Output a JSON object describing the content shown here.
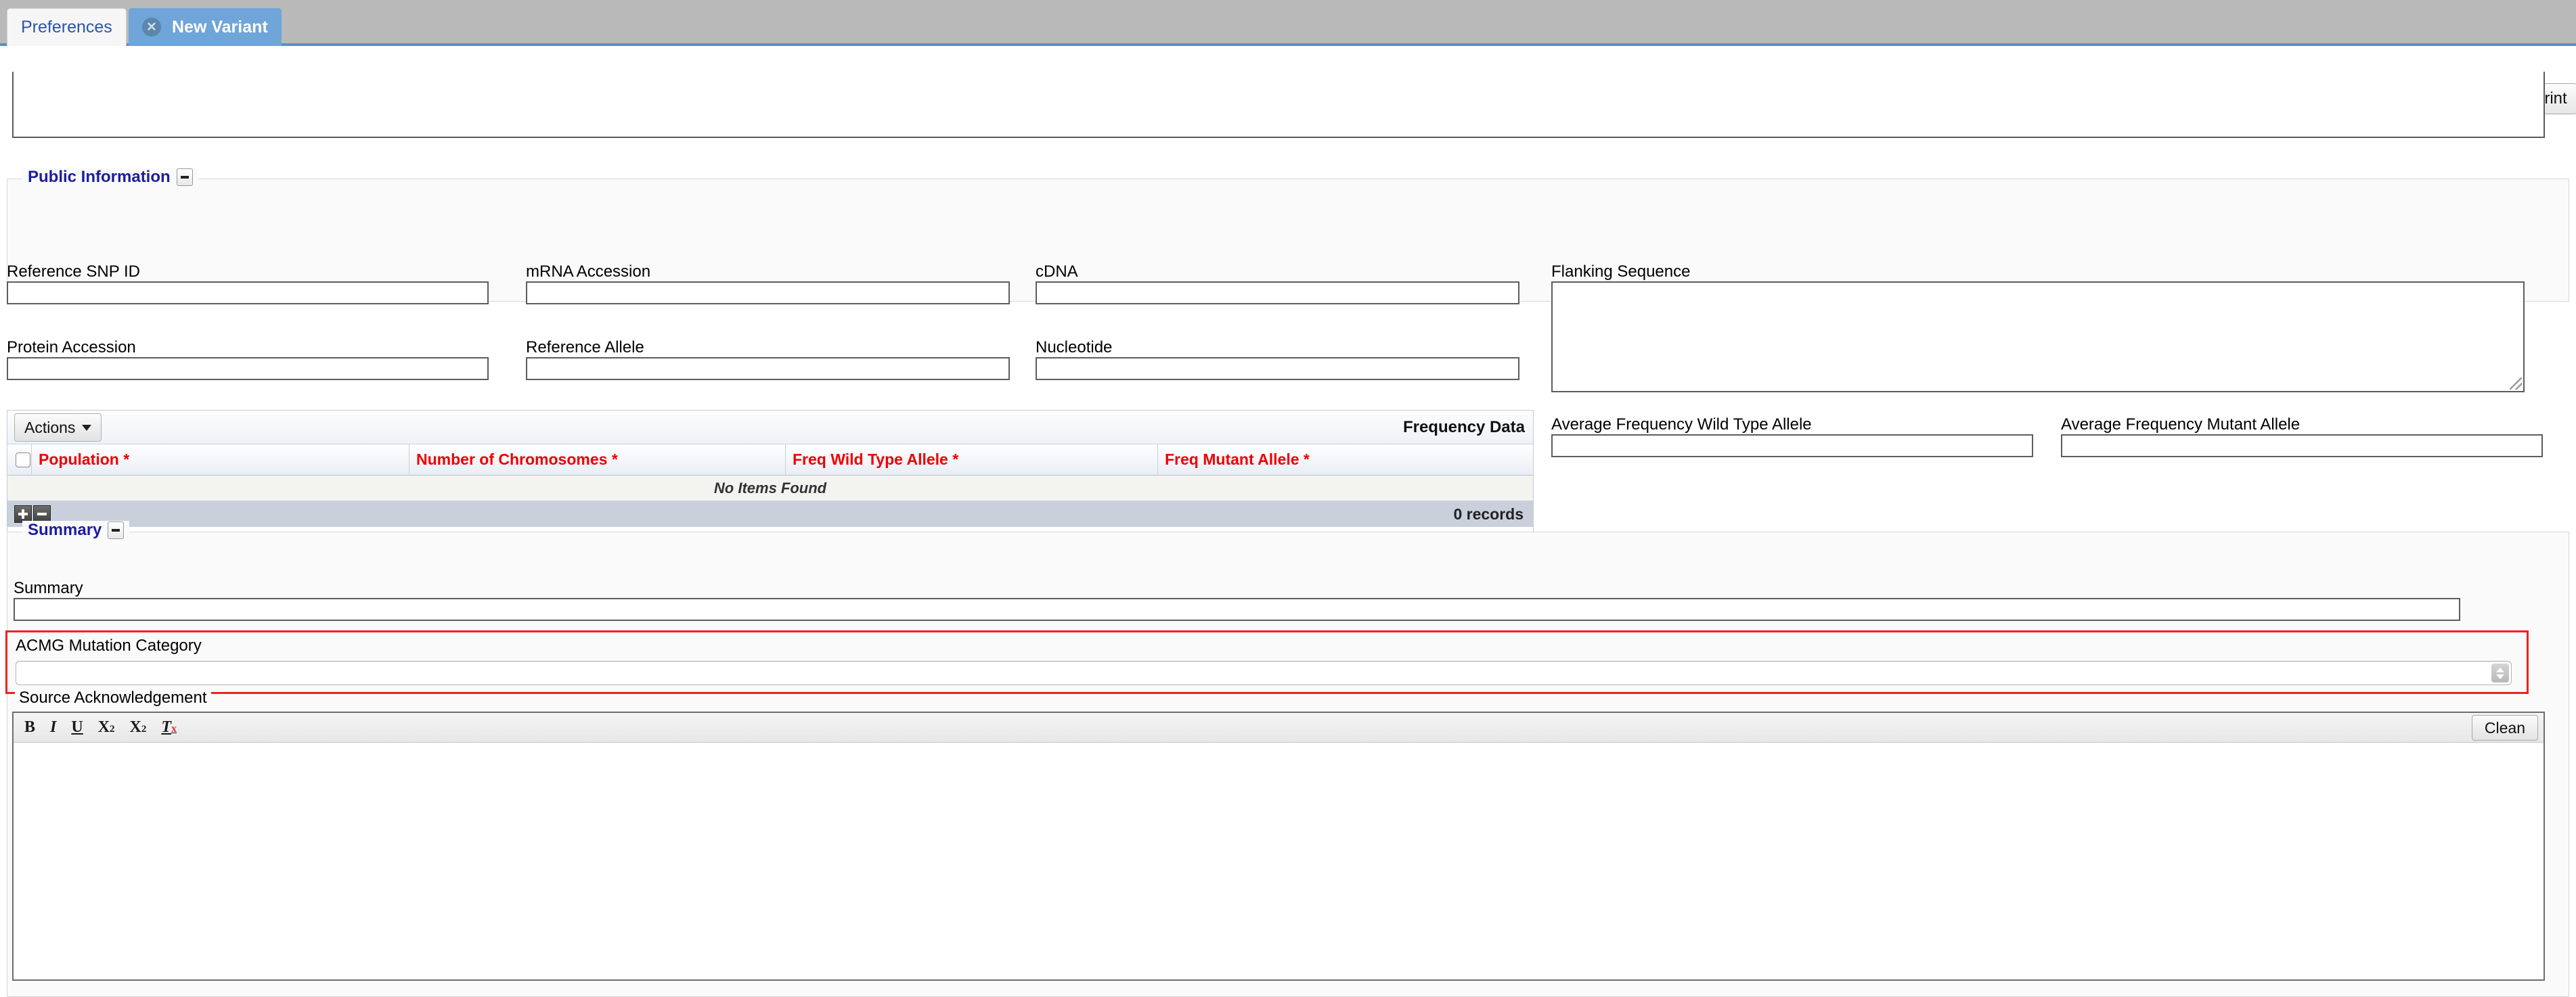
{
  "tabs": [
    {
      "label": "Preferences",
      "active": false
    },
    {
      "label": "New Variant",
      "active": true,
      "close_icon": "close-circle-icon"
    }
  ],
  "toolbar": {
    "print_label": "Print"
  },
  "public_information": {
    "legend": "Public Information",
    "collapse_icon": "minus-box-icon",
    "fields": [
      {
        "label": "Reference SNP ID",
        "value": ""
      },
      {
        "label": "mRNA Accession",
        "value": ""
      },
      {
        "label": "cDNA",
        "value": ""
      },
      {
        "label": "Flanking Sequence",
        "value": ""
      },
      {
        "label": "Protein Accession",
        "value": ""
      },
      {
        "label": "Reference Allele",
        "value": ""
      },
      {
        "label": "Nucleotide",
        "value": ""
      },
      {
        "label": "Average Frequency Wild Type Allele",
        "value": ""
      },
      {
        "label": "Average Frequency Mutant Allele",
        "value": ""
      }
    ]
  },
  "frequency_table": {
    "title": "Frequency Data",
    "actions_label": "Actions",
    "caret_icon": "caret-down-icon",
    "select_all_icon": "checkbox-icon",
    "columns": [
      "Population *",
      "Number of Chromosomes *",
      "Freq Wild Type Allele *",
      "Freq Mutant Allele *"
    ],
    "rows": [],
    "empty_message": "No Items Found",
    "record_count": "0 records",
    "add_icon": "plus-icon",
    "remove_icon": "minus-icon"
  },
  "summary": {
    "legend": "Summary",
    "collapse_icon": "minus-box-icon",
    "summary_label": "Summary",
    "summary_value": "",
    "acmg_label": "ACMG Mutation Category",
    "acmg_value": "",
    "acmg_stepper_icon": "stepper-updown-icon"
  },
  "source_acknowledgement": {
    "label": "Source Acknowledgement",
    "toolbar": [
      {
        "name": "bold-icon",
        "glyph": "B"
      },
      {
        "name": "italic-icon",
        "glyph": "I"
      },
      {
        "name": "underline-icon",
        "glyph": "U"
      },
      {
        "name": "subscript-icon",
        "glyph": "X",
        "affix": "2"
      },
      {
        "name": "superscript-icon",
        "glyph": "X",
        "affix": "2"
      },
      {
        "name": "remove-format-icon",
        "glyph": "T",
        "affix": "x"
      }
    ],
    "clean_label": "Clean",
    "body_value": ""
  },
  "colors": {
    "tab_active_bg": "#6fa5d8",
    "tab_link": "#2a55a8",
    "legend_text": "#1d1d9e",
    "required_column": "#ee0000",
    "error_border": "#ef2020",
    "table_footer": "#c9d0dc"
  }
}
